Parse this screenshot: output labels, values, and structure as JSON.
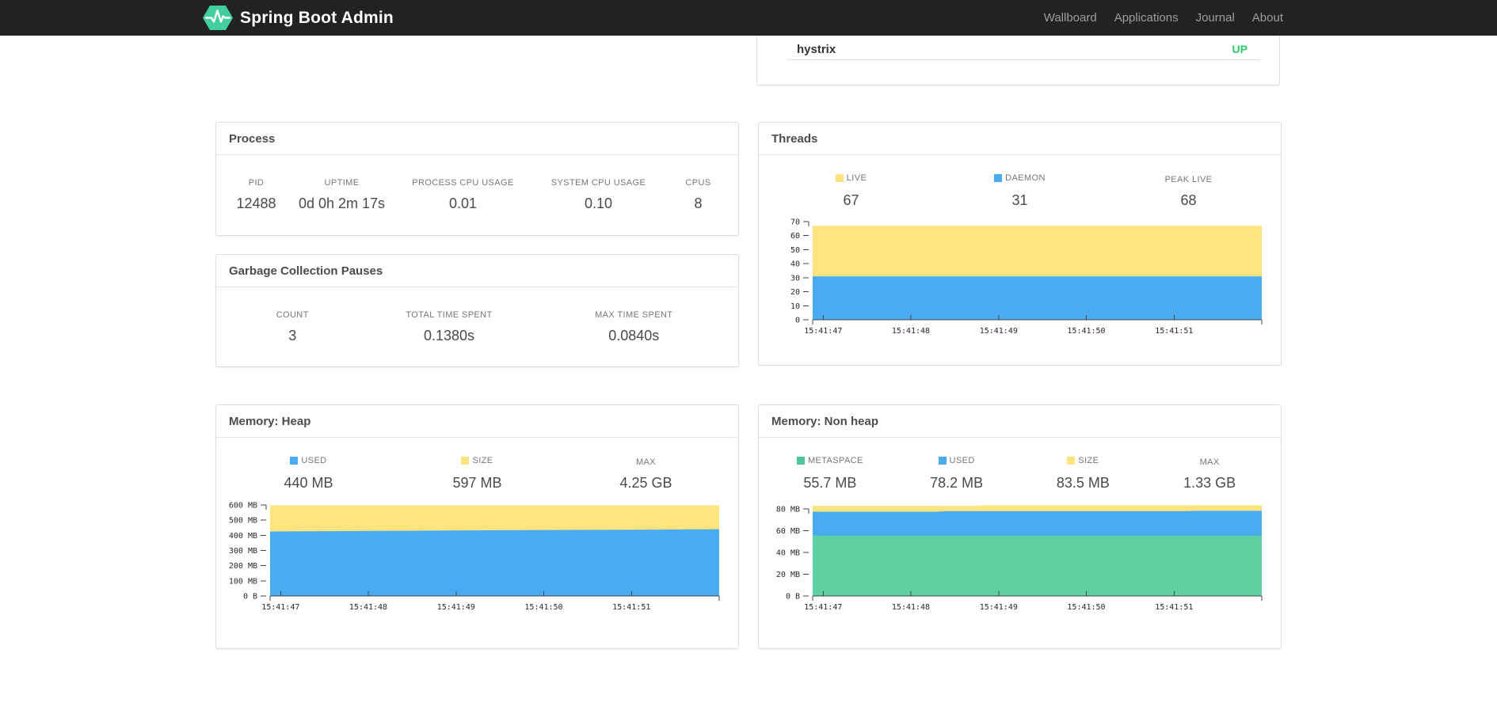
{
  "navbar": {
    "brand": "Spring Boot Admin",
    "links": [
      {
        "id": "wallboard",
        "label": "Wallboard"
      },
      {
        "id": "applications",
        "label": "Applications"
      },
      {
        "id": "journal",
        "label": "Journal"
      },
      {
        "id": "about",
        "label": "About"
      }
    ]
  },
  "colors": {
    "navbar_bg": "#222222",
    "nav_link": "#9d9d9d",
    "brand_green": "#42ce9f",
    "status_up": "#28ca66",
    "series_yellow": "#fde47f",
    "series_blue": "#49acf1",
    "series_green": "#5fd0a2",
    "swatch_green": "#4cc79b"
  },
  "service_card": {
    "rows": [
      {
        "name": "hystrix",
        "status": "UP"
      }
    ]
  },
  "cards": {
    "process": {
      "title": "Process",
      "stats": [
        {
          "label": "PID",
          "value": "12488"
        },
        {
          "label": "UPTIME",
          "value": "0d 0h 2m 17s"
        },
        {
          "label": "PROCESS CPU USAGE",
          "value": "0.01"
        },
        {
          "label": "SYSTEM CPU USAGE",
          "value": "0.10"
        },
        {
          "label": "CPUS",
          "value": "8"
        }
      ]
    },
    "gc": {
      "title": "Garbage Collection Pauses",
      "stats": [
        {
          "label": "COUNT",
          "value": "3"
        },
        {
          "label": "TOTAL TIME SPENT",
          "value": "0.1380s"
        },
        {
          "label": "MAX TIME SPENT",
          "value": "0.0840s"
        }
      ]
    },
    "threads": {
      "title": "Threads",
      "stats": [
        {
          "label": "LIVE",
          "value": "67",
          "swatch": "#fde47f"
        },
        {
          "label": "DAEMON",
          "value": "31",
          "swatch": "#49acf1"
        },
        {
          "label": "PEAK LIVE",
          "value": "68"
        }
      ]
    },
    "memory_heap": {
      "title": "Memory: Heap",
      "stats": [
        {
          "label": "USED",
          "value": "440 MB",
          "swatch": "#49acf1"
        },
        {
          "label": "SIZE",
          "value": "597 MB",
          "swatch": "#fde47f"
        },
        {
          "label": "MAX",
          "value": "4.25 GB"
        }
      ]
    },
    "memory_nonheap": {
      "title": "Memory: Non heap",
      "stats": [
        {
          "label": "METASPACE",
          "value": "55.7 MB",
          "swatch": "#4cc79b"
        },
        {
          "label": "USED",
          "value": "78.2 MB",
          "swatch": "#49acf1"
        },
        {
          "label": "SIZE",
          "value": "83.5 MB",
          "swatch": "#fde47f"
        },
        {
          "label": "MAX",
          "value": "1.33 GB"
        }
      ]
    }
  },
  "chart_data": [
    {
      "id": "threads",
      "type": "area",
      "title": "Threads",
      "x_unit": "time (15:41:ss)",
      "xlim": [
        46.88,
        52.0
      ],
      "xticks": [
        {
          "v": 47,
          "label": "15:41:47"
        },
        {
          "v": 48,
          "label": "15:41:48"
        },
        {
          "v": 49,
          "label": "15:41:49"
        },
        {
          "v": 50,
          "label": "15:41:50"
        },
        {
          "v": 51,
          "label": "15:41:51"
        }
      ],
      "ylim": [
        0,
        70
      ],
      "yticks": [
        {
          "v": 0,
          "label": "0"
        },
        {
          "v": 10,
          "label": "10"
        },
        {
          "v": 20,
          "label": "20"
        },
        {
          "v": 30,
          "label": "30"
        },
        {
          "v": 40,
          "label": "40"
        },
        {
          "v": 50,
          "label": "50"
        },
        {
          "v": 60,
          "label": "60"
        },
        {
          "v": 70,
          "label": "70"
        }
      ],
      "series": [
        {
          "name": "LIVE",
          "color": "#fde47f",
          "points": [
            [
              46.88,
              67
            ],
            [
              52.0,
              67
            ]
          ]
        },
        {
          "name": "DAEMON",
          "color": "#49acf1",
          "points": [
            [
              46.88,
              31
            ],
            [
              52.0,
              31
            ]
          ]
        }
      ]
    },
    {
      "id": "memory-heap",
      "type": "area",
      "title": "Memory: Heap (MB)",
      "x_unit": "time (15:41:ss)",
      "xlim": [
        46.88,
        52.0
      ],
      "xticks": [
        {
          "v": 47,
          "label": "15:41:47"
        },
        {
          "v": 48,
          "label": "15:41:48"
        },
        {
          "v": 49,
          "label": "15:41:49"
        },
        {
          "v": 50,
          "label": "15:41:50"
        },
        {
          "v": 51,
          "label": "15:41:51"
        }
      ],
      "ylim": [
        0,
        615
      ],
      "yticks": [
        {
          "v": 0,
          "label": "0 B"
        },
        {
          "v": 100,
          "label": "100 MB"
        },
        {
          "v": 200,
          "label": "200 MB"
        },
        {
          "v": 300,
          "label": "300 MB"
        },
        {
          "v": 400,
          "label": "400 MB"
        },
        {
          "v": 500,
          "label": "500 MB"
        },
        {
          "v": 600,
          "label": "600 MB"
        }
      ],
      "series": [
        {
          "name": "SIZE",
          "color": "#fde47f",
          "points": [
            [
              46.88,
              597
            ],
            [
              52.0,
              597
            ]
          ]
        },
        {
          "name": "USED",
          "color": "#49acf1",
          "points": [
            [
              46.88,
              425
            ],
            [
              47.6,
              427
            ],
            [
              48.2,
              429
            ],
            [
              48.9,
              431
            ],
            [
              49.6,
              433
            ],
            [
              50.3,
              435
            ],
            [
              51.1,
              437
            ],
            [
              52.0,
              440
            ]
          ]
        }
      ]
    },
    {
      "id": "memory-nonheap",
      "type": "area",
      "title": "Memory: Non heap (MB)",
      "x_unit": "time (15:41:ss)",
      "xlim": [
        46.88,
        52.0
      ],
      "xticks": [
        {
          "v": 47,
          "label": "15:41:47"
        },
        {
          "v": 48,
          "label": "15:41:48"
        },
        {
          "v": 49,
          "label": "15:41:49"
        },
        {
          "v": 50,
          "label": "15:41:50"
        },
        {
          "v": 51,
          "label": "15:41:51"
        }
      ],
      "ylim": [
        0,
        86
      ],
      "yticks": [
        {
          "v": 0,
          "label": "0 B"
        },
        {
          "v": 20,
          "label": "20 MB"
        },
        {
          "v": 40,
          "label": "40 MB"
        },
        {
          "v": 60,
          "label": "60 MB"
        },
        {
          "v": 80,
          "label": "80 MB"
        }
      ],
      "series": [
        {
          "name": "SIZE",
          "color": "#fde47f",
          "points": [
            [
              46.88,
              83.0
            ],
            [
              48.75,
              83.0
            ],
            [
              48.85,
              83.5
            ],
            [
              52.0,
              83.5
            ]
          ]
        },
        {
          "name": "USED",
          "color": "#49acf1",
          "points": [
            [
              46.88,
              77.6
            ],
            [
              48.3,
              77.6
            ],
            [
              48.4,
              78.1
            ],
            [
              51.15,
              78.1
            ],
            [
              51.25,
              78.4
            ],
            [
              52.0,
              78.4
            ]
          ]
        },
        {
          "name": "METASPACE",
          "color": "#5fd0a2",
          "points": [
            [
              46.88,
              55.7
            ],
            [
              52.0,
              55.7
            ]
          ]
        }
      ]
    }
  ]
}
